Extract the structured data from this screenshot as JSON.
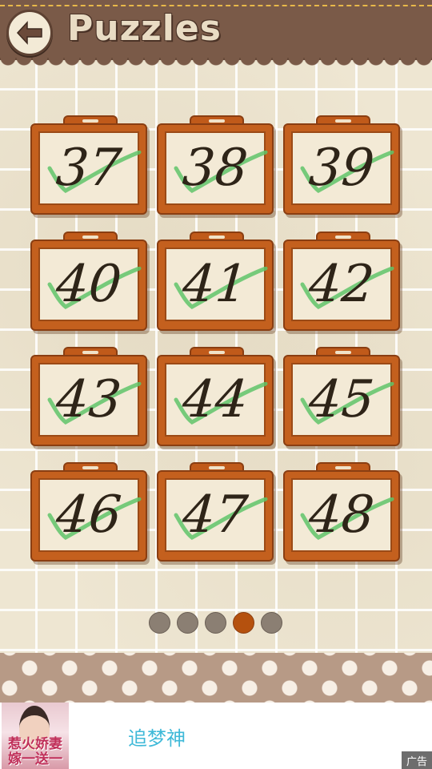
{
  "header": {
    "title": "Puzzles",
    "back_icon": "back-arrow-icon"
  },
  "puzzles": [
    {
      "number": "37",
      "completed": true
    },
    {
      "number": "38",
      "completed": true
    },
    {
      "number": "39",
      "completed": true
    },
    {
      "number": "40",
      "completed": true
    },
    {
      "number": "41",
      "completed": true
    },
    {
      "number": "42",
      "completed": true
    },
    {
      "number": "43",
      "completed": true
    },
    {
      "number": "44",
      "completed": true
    },
    {
      "number": "45",
      "completed": true
    },
    {
      "number": "46",
      "completed": true
    },
    {
      "number": "47",
      "completed": true
    },
    {
      "number": "48",
      "completed": true
    }
  ],
  "pagination": {
    "pages": 5,
    "current": 4
  },
  "ad": {
    "image_text_line1": "惹火娇妻",
    "image_text_line2": "嫁一送一",
    "text": "追梦神",
    "badge": "广告"
  },
  "colors": {
    "header": "#7a5a48",
    "frame": "#c4601e",
    "check": "#5fc46a",
    "active_dot": "#b5510e",
    "inactive_dot": "#8b7f73"
  }
}
